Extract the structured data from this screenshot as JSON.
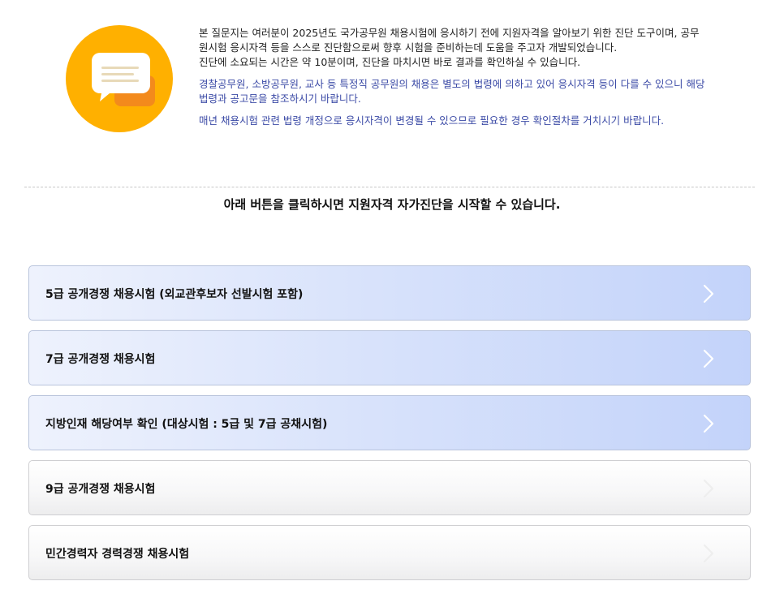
{
  "intro": {
    "icon": "chat-bubbles-icon",
    "colors": {
      "circle": "#ffb000",
      "back_bubble": "#f38a1c",
      "front_bubble": "#ffffff",
      "lines": "#e8d9b8"
    },
    "paragraph1_line1": "본 질문지는 여러분이 2025년도 국가공무원 채용시험에 응시하기 전에 지원자격을 알아보기 위한 진단 도구이며, 공무",
    "paragraph1_line2": "원시험 응시자격 등을 스스로 진단함으로써 향후 시험을 준비하는데 도움을 주고자 개발되었습니다.",
    "paragraph1_line3": "진단에 소요되는 시간은 약 10분이며, 진단을 마치시면 바로 결과를 확인하실 수 있습니다.",
    "notice1_line1": "경찰공무원, 소방공무원, 교사 등 특정직 공무원의 채용은 별도의 법령에 의하고 있어 응시자격 등이 다를 수 있으니 해당",
    "notice1_line2": "법령과 공고문을 참조하시기 바랍니다.",
    "notice2": "매년 채용시험 관련 법령 개정으로 응시자격이 변경될 수 있으므로 필요한 경우 확인절차를 거치시기 바랍니다."
  },
  "guide_text": "아래 버튼을 클릭하시면 지원자격 자가진단을 시작할 수 있습니다.",
  "exams": [
    {
      "label": "5급 공개경쟁 채용시험 (외교관후보자 선발시험 포함)",
      "style": "active"
    },
    {
      "label": "7급 공개경쟁 채용시험",
      "style": "active"
    },
    {
      "label": "지방인재 해당여부 확인 (대상시험 : 5급 및 7급 공채시험)",
      "style": "active"
    },
    {
      "label": "9급 공개경쟁 채용시험",
      "style": "normal"
    },
    {
      "label": "민간경력자 경력경쟁 채용시험",
      "style": "normal"
    }
  ],
  "chevron_icon": "chevron-right-icon",
  "chevron_colors": {
    "active": "#ffffff",
    "normal": "#eeeeee"
  }
}
